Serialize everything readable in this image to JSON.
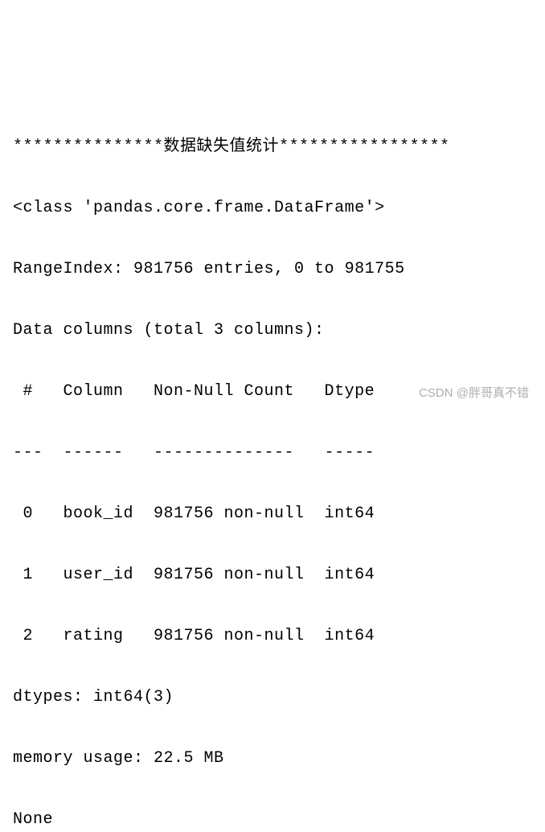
{
  "header": "***************数据缺失值统计*****************",
  "class_line": "<class 'pandas.core.frame.DataFrame'>",
  "rangeindex": "RangeIndex: 981756 entries, 0 to 981755",
  "data_columns": "Data columns (total 3 columns):",
  "col_header": " #   Column   Non-Null Count   Dtype",
  "col_sep": "---  ------   --------------   -----",
  "rows": [
    " 0   book_id  981756 non-null  int64",
    " 1   user_id  981756 non-null  int64",
    " 2   rating   981756 non-null  int64"
  ],
  "dtypes": "dtypes: int64(3)",
  "memory": "memory usage: 22.5 MB",
  "none": "None",
  "watermark": "CSDN @胖哥真不错"
}
